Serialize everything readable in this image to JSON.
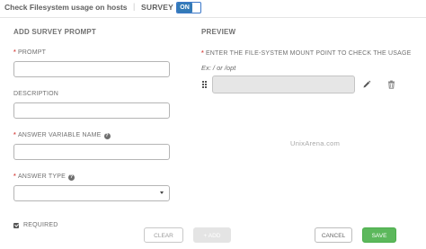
{
  "header": {
    "title": "Check Filesystem usage on hosts",
    "separator": "|",
    "survey_label": "SURVEY",
    "toggle_label": "ON"
  },
  "add_prompt": {
    "heading": "ADD SURVEY PROMPT",
    "required_marker": "*",
    "prompt_label": "PROMPT",
    "prompt_value": "",
    "description_label": "DESCRIPTION",
    "description_value": "",
    "answer_variable_label": "ANSWER VARIABLE NAME",
    "answer_variable_value": "",
    "answer_type_label": "ANSWER TYPE",
    "answer_type_value": "",
    "required_label": "REQUIRED",
    "required_checked": true
  },
  "preview": {
    "heading": "PREVIEW",
    "question_label": "ENTER THE FILE-SYSTEM MOUNT POINT TO CHECK THE USAGE",
    "hint": "Ex: / or /opt",
    "answer_value": ""
  },
  "watermark": "UnixArena.com",
  "buttons": {
    "clear": "CLEAR",
    "add": "+ ADD",
    "cancel": "CANCEL",
    "save": "SAVE"
  },
  "icons": {
    "drag_handle": "drag-handle-icon",
    "edit": "pencil-icon",
    "delete": "trash-icon",
    "help": "question-circle-icon",
    "dropdown": "caret-down-icon"
  },
  "colors": {
    "toggle_on": "#337ab7",
    "required_asterisk": "#d9534f",
    "save_button": "#5cb85c"
  }
}
